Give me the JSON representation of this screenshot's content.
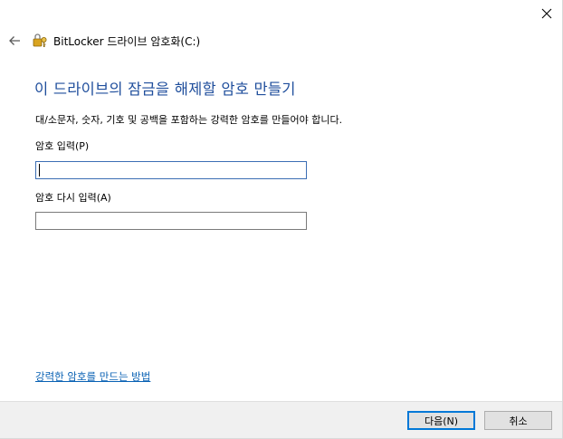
{
  "window": {
    "title": "BitLocker 드라이브 암호화(C:)",
    "close_icon": "close-icon",
    "back_icon": "back-arrow-icon",
    "app_icon": "bitlocker-key-icon"
  },
  "main": {
    "heading": "이 드라이브의 잠금을 해제할 암호 만들기",
    "description": "대/소문자, 숫자, 기호 및 공백을 포함하는 강력한 암호를 만들어야 합니다.",
    "password_label": "암호 입력(P)",
    "password_value": "",
    "confirm_label": "암호 다시 입력(A)",
    "confirm_value": "",
    "help_link": "강력한 암호를 만드는 방법"
  },
  "footer": {
    "next_label": "다음(N)",
    "cancel_label": "취소"
  },
  "colors": {
    "heading": "#1f4e9c",
    "link": "#0a62b4",
    "footer_bg": "#f0f0f0",
    "focus_border": "#0078d7"
  }
}
